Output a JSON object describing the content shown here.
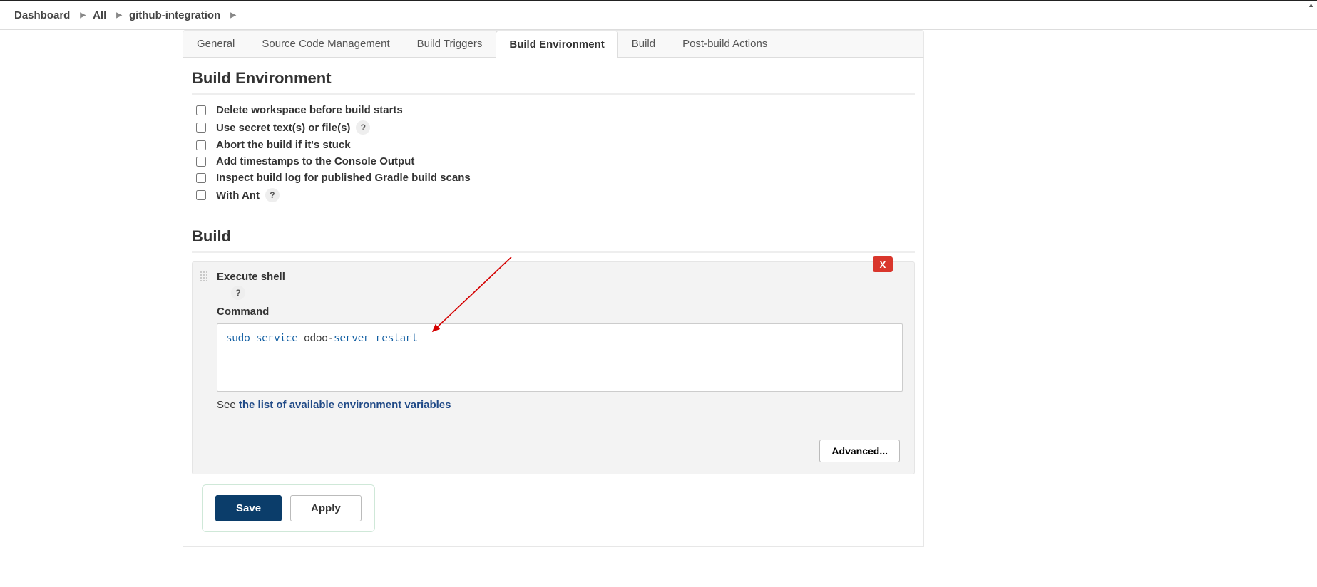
{
  "breadcrumb": {
    "items": [
      "Dashboard",
      "All",
      "github-integration"
    ]
  },
  "tabs": [
    {
      "label": "General",
      "active": false
    },
    {
      "label": "Source Code Management",
      "active": false
    },
    {
      "label": "Build Triggers",
      "active": false
    },
    {
      "label": "Build Environment",
      "active": true
    },
    {
      "label": "Build",
      "active": false
    },
    {
      "label": "Post-build Actions",
      "active": false
    }
  ],
  "sections": {
    "build_env": {
      "title": "Build Environment",
      "options": [
        {
          "label": "Delete workspace before build starts",
          "help": false
        },
        {
          "label": "Use secret text(s) or file(s)",
          "help": true
        },
        {
          "label": "Abort the build if it's stuck",
          "help": false
        },
        {
          "label": "Add timestamps to the Console Output",
          "help": false
        },
        {
          "label": "Inspect build log for published Gradle build scans",
          "help": false
        },
        {
          "label": "With Ant",
          "help": true
        }
      ]
    },
    "build": {
      "title": "Build",
      "step": {
        "title": "Execute shell",
        "command_label": "Command",
        "command_tokens": [
          {
            "t": "sudo",
            "c": "kw"
          },
          {
            "t": " ",
            "c": "sp"
          },
          {
            "t": "service",
            "c": "kw"
          },
          {
            "t": " ",
            "c": "sp"
          },
          {
            "t": "odoo",
            "c": "id"
          },
          {
            "t": "-",
            "c": "id"
          },
          {
            "t": "server",
            "c": "kw"
          },
          {
            "t": " ",
            "c": "sp"
          },
          {
            "t": "restart",
            "c": "kw"
          }
        ],
        "see_prefix": "See ",
        "see_link": "the list of available environment variables",
        "advanced_label": "Advanced...",
        "delete_label": "X"
      }
    }
  },
  "buttons": {
    "save": "Save",
    "apply": "Apply"
  }
}
